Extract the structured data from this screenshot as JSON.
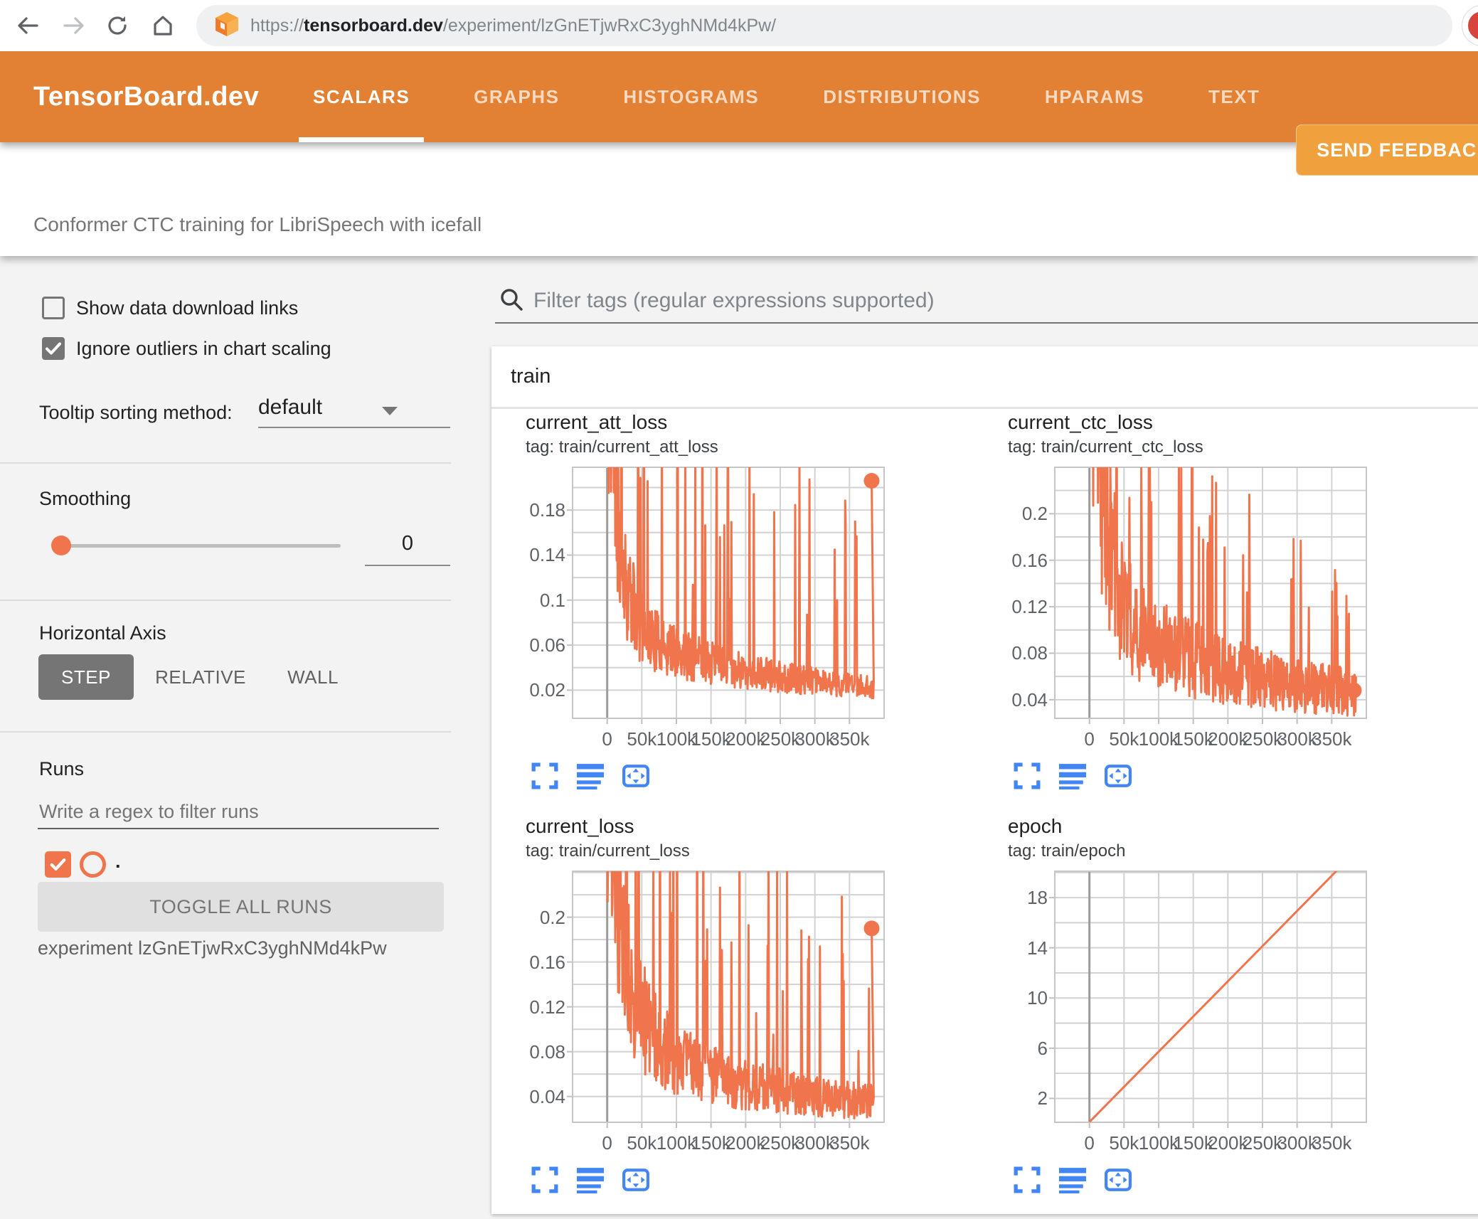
{
  "browser": {
    "url_scheme": "https://",
    "url_domain": "tensorboard.dev",
    "url_path": "/experiment/lzGnETjwRxC3yghNMd4kPw/",
    "icons": [
      "back-icon",
      "forward-icon",
      "reload-icon",
      "home-icon",
      "tensorboard-logo-icon",
      "profile-avatar"
    ]
  },
  "header": {
    "brand": "TensorBoard.dev",
    "tabs": [
      {
        "label": "SCALARS",
        "active": true
      },
      {
        "label": "GRAPHS",
        "active": false
      },
      {
        "label": "HISTOGRAMS",
        "active": false
      },
      {
        "label": "DISTRIBUTIONS",
        "active": false
      },
      {
        "label": "HPARAMS",
        "active": false
      },
      {
        "label": "TEXT",
        "active": false
      }
    ],
    "feedback_label": "SEND FEEDBACK"
  },
  "title_bar": {
    "experiment_title": "Conformer CTC training for LibriSpeech with icefall"
  },
  "sidebar": {
    "checkbox_show_links": {
      "label": "Show data download links",
      "checked": false
    },
    "checkbox_outliers": {
      "label": "Ignore outliers in chart scaling",
      "checked": true
    },
    "tooltip_sort": {
      "label": "Tooltip sorting method:",
      "value": "default"
    },
    "smoothing": {
      "label": "Smoothing",
      "value": "0"
    },
    "horizontal_axis": {
      "label": "Horizontal Axis",
      "options": [
        "STEP",
        "RELATIVE",
        "WALL"
      ],
      "selected": "STEP"
    },
    "runs": {
      "label": "Runs",
      "filter_placeholder": "Write a regex to filter runs",
      "run_name": ".",
      "run_checked": true,
      "toggle_button": "TOGGLE ALL RUNS",
      "experiment_caption": "experiment lzGnETjwRxC3yghNMd4kPw"
    }
  },
  "main": {
    "filter_placeholder": "Filter tags (regular expressions supported)",
    "group_label": "train",
    "chart_action_icons": [
      "fullscreen-icon",
      "log-scale-icon",
      "fit-data-icon"
    ]
  },
  "colors": {
    "header_orange": "#e28134",
    "feedback_orange": "#f0a13e",
    "run_orange": "#f0744c",
    "icon_blue": "#4285f4",
    "grid_gray": "#d2d2d2",
    "axis_label_gray": "#5f6368"
  },
  "chart_data": [
    {
      "type": "line",
      "title": "current_att_loss",
      "tag": "tag: train/current_att_loss",
      "color": "#f0744c",
      "x_ticks": [
        {
          "v": 0,
          "label": "0"
        },
        {
          "v": 50000,
          "label": "50k"
        },
        {
          "v": 100000,
          "label": "100k"
        },
        {
          "v": 150000,
          "label": "150k"
        },
        {
          "v": 200000,
          "label": "200k"
        },
        {
          "v": 250000,
          "label": "250k"
        },
        {
          "v": 300000,
          "label": "300k"
        },
        {
          "v": 350000,
          "label": "350k"
        }
      ],
      "xlim": [
        -50000,
        400000
      ],
      "y_ticks": [
        {
          "v": 0.02,
          "label": "0.02"
        },
        {
          "v": 0.06,
          "label": "0.06"
        },
        {
          "v": 0.1,
          "label": "0.1"
        },
        {
          "v": 0.14,
          "label": "0.14"
        },
        {
          "v": 0.18,
          "label": "0.18"
        }
      ],
      "y_grid": {
        "start": 0.02,
        "step": 0.02,
        "end": 0.2
      },
      "ylim": [
        -0.005,
        0.218
      ],
      "line_style": "noisy",
      "trend": [
        [
          0,
          0.32
        ],
        [
          8000,
          0.24
        ],
        [
          15000,
          0.18
        ],
        [
          25000,
          0.12
        ],
        [
          35000,
          0.095
        ],
        [
          50000,
          0.075
        ],
        [
          70000,
          0.062
        ],
        [
          100000,
          0.052
        ],
        [
          140000,
          0.045
        ],
        [
          180000,
          0.038
        ],
        [
          220000,
          0.034
        ],
        [
          260000,
          0.03
        ],
        [
          300000,
          0.027
        ],
        [
          340000,
          0.024
        ],
        [
          385000,
          0.022
        ]
      ],
      "noise": {
        "jitter": [
          0.58,
          1.48
        ],
        "spike_p": 0.065,
        "spike_mult": [
          2.2,
          8.0
        ],
        "points": 560,
        "seed": 11
      },
      "end_dot": [
        382000,
        0.206
      ]
    },
    {
      "type": "line",
      "title": "current_ctc_loss",
      "tag": "tag: train/current_ctc_loss",
      "color": "#f0744c",
      "x_ticks": [
        {
          "v": 0,
          "label": "0"
        },
        {
          "v": 50000,
          "label": "50k"
        },
        {
          "v": 100000,
          "label": "100k"
        },
        {
          "v": 150000,
          "label": "150k"
        },
        {
          "v": 200000,
          "label": "200k"
        },
        {
          "v": 250000,
          "label": "250k"
        },
        {
          "v": 300000,
          "label": "300k"
        },
        {
          "v": 350000,
          "label": "350k"
        }
      ],
      "xlim": [
        -50000,
        400000
      ],
      "y_ticks": [
        {
          "v": 0.04,
          "label": "0.04"
        },
        {
          "v": 0.08,
          "label": "0.08"
        },
        {
          "v": 0.12,
          "label": "0.12"
        },
        {
          "v": 0.16,
          "label": "0.16"
        },
        {
          "v": 0.2,
          "label": "0.2"
        }
      ],
      "y_grid": {
        "start": 0.04,
        "step": 0.02,
        "end": 0.24
      },
      "ylim": [
        0.024,
        0.24
      ],
      "line_style": "noisy",
      "trend": [
        [
          0,
          0.4
        ],
        [
          10000,
          0.3
        ],
        [
          20000,
          0.22
        ],
        [
          30000,
          0.17
        ],
        [
          45000,
          0.13
        ],
        [
          60000,
          0.11
        ],
        [
          80000,
          0.095
        ],
        [
          110000,
          0.085
        ],
        [
          150000,
          0.075
        ],
        [
          200000,
          0.065
        ],
        [
          250000,
          0.058
        ],
        [
          300000,
          0.052
        ],
        [
          350000,
          0.048
        ],
        [
          385000,
          0.046
        ]
      ],
      "noise": {
        "jitter": [
          0.55,
          1.45
        ],
        "spike_p": 0.06,
        "spike_mult": [
          1.7,
          3.6
        ],
        "points": 560,
        "seed": 23
      },
      "end_dot": [
        382000,
        0.048
      ]
    },
    {
      "type": "line",
      "title": "current_loss",
      "tag": "tag: train/current_loss",
      "color": "#f0744c",
      "x_ticks": [
        {
          "v": 0,
          "label": "0"
        },
        {
          "v": 50000,
          "label": "50k"
        },
        {
          "v": 100000,
          "label": "100k"
        },
        {
          "v": 150000,
          "label": "150k"
        },
        {
          "v": 200000,
          "label": "200k"
        },
        {
          "v": 250000,
          "label": "250k"
        },
        {
          "v": 300000,
          "label": "300k"
        },
        {
          "v": 350000,
          "label": "350k"
        }
      ],
      "xlim": [
        -50000,
        400000
      ],
      "y_ticks": [
        {
          "v": 0.04,
          "label": "0.04"
        },
        {
          "v": 0.08,
          "label": "0.08"
        },
        {
          "v": 0.12,
          "label": "0.12"
        },
        {
          "v": 0.16,
          "label": "0.16"
        },
        {
          "v": 0.2,
          "label": "0.2"
        }
      ],
      "y_grid": {
        "start": 0.04,
        "step": 0.02,
        "end": 0.24
      },
      "ylim": [
        0.017,
        0.241
      ],
      "line_style": "noisy",
      "trend": [
        [
          0,
          0.38
        ],
        [
          10000,
          0.28
        ],
        [
          20000,
          0.2
        ],
        [
          30000,
          0.15
        ],
        [
          45000,
          0.12
        ],
        [
          60000,
          0.1
        ],
        [
          80000,
          0.085
        ],
        [
          110000,
          0.07
        ],
        [
          150000,
          0.06
        ],
        [
          200000,
          0.05
        ],
        [
          250000,
          0.045
        ],
        [
          300000,
          0.04
        ],
        [
          350000,
          0.037
        ],
        [
          385000,
          0.035
        ]
      ],
      "noise": {
        "jitter": [
          0.55,
          1.45
        ],
        "spike_p": 0.06,
        "spike_mult": [
          2.0,
          5.8
        ],
        "points": 560,
        "seed": 37
      },
      "end_dot": [
        382000,
        0.19
      ]
    },
    {
      "type": "line",
      "title": "epoch",
      "tag": "tag: train/epoch",
      "color": "#f0744c",
      "x_ticks": [
        {
          "v": 0,
          "label": "0"
        },
        {
          "v": 50000,
          "label": "50k"
        },
        {
          "v": 100000,
          "label": "100k"
        },
        {
          "v": 150000,
          "label": "150k"
        },
        {
          "v": 200000,
          "label": "200k"
        },
        {
          "v": 250000,
          "label": "250k"
        },
        {
          "v": 300000,
          "label": "300k"
        },
        {
          "v": 350000,
          "label": "350k"
        }
      ],
      "xlim": [
        -50000,
        400000
      ],
      "y_ticks": [
        {
          "v": 2,
          "label": "2"
        },
        {
          "v": 6,
          "label": "6"
        },
        {
          "v": 10,
          "label": "10"
        },
        {
          "v": 14,
          "label": "14"
        },
        {
          "v": 18,
          "label": "18"
        }
      ],
      "y_grid": {
        "start": 2,
        "step": 2,
        "end": 20
      },
      "ylim": [
        0.1,
        20.1
      ],
      "line_style": "straight",
      "points": [
        [
          0,
          0.12
        ],
        [
          385000,
          21.7
        ]
      ],
      "end_dot": null
    }
  ]
}
